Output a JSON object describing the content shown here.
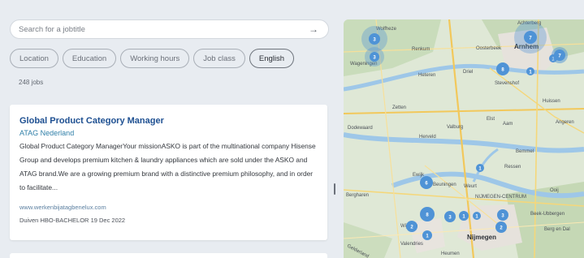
{
  "search": {
    "placeholder": "Search for a jobtitle",
    "arrow_icon": "arrow-right-icon"
  },
  "filters": [
    {
      "label": "Location",
      "active": false
    },
    {
      "label": "Education",
      "active": false
    },
    {
      "label": "Working hours",
      "active": false
    },
    {
      "label": "Job class",
      "active": false
    },
    {
      "label": "English",
      "active": true
    }
  ],
  "results": {
    "count_text": "248 jobs"
  },
  "job": {
    "title": "Global Product Category Manager",
    "company": "ATAG Nederland",
    "description": "Global Product Category ManagerYour missionASKO is part of the multinational company Hisense Group and develops premium kitchen & laundry appliances which are sold under the ASKO and ATAG brand.We are a growing premium brand with a distinctive premium philosophy, and in order to facilitate...",
    "website": "www.werkenbijatagbenelux.com",
    "location": "Duiven",
    "education": "HBO-BACHELOR",
    "date": "19 Dec 2022"
  },
  "map": {
    "places": [
      "Wolfheze",
      "Renkum",
      "Oosterbeek",
      "Arnhem",
      "Wageningen",
      "Heteren",
      "Driel",
      "Zetten",
      "Elst",
      "Aam",
      "Huissen",
      "Dodewaard",
      "Herveld",
      "Valburg",
      "Angeren",
      "Bemmel",
      "Ewijk",
      "Beuningen",
      "Weurt",
      "Ressen",
      "Ooij",
      "Nijmegen",
      "Wijchen",
      "Beek-Ubbergen",
      "Berg en Dal",
      "Valendries",
      "Heumen",
      "Bergharen",
      "Gelderland",
      "NIJMEGEN-CENTRUM",
      "Stevenshof",
      "Achterberg"
    ],
    "clusters": [
      {
        "count": "3"
      },
      {
        "count": "3"
      },
      {
        "count": "7"
      },
      {
        "count": "8"
      },
      {
        "count": "1"
      },
      {
        "count": "1"
      },
      {
        "count": "7"
      },
      {
        "count": "6"
      },
      {
        "count": "1"
      },
      {
        "count": "3"
      },
      {
        "count": "8"
      },
      {
        "count": "3"
      },
      {
        "count": "1"
      },
      {
        "count": "1"
      },
      {
        "count": "2"
      },
      {
        "count": "1"
      },
      {
        "count": "2"
      },
      {
        "count": "5"
      },
      {
        "count": "1"
      }
    ]
  }
}
